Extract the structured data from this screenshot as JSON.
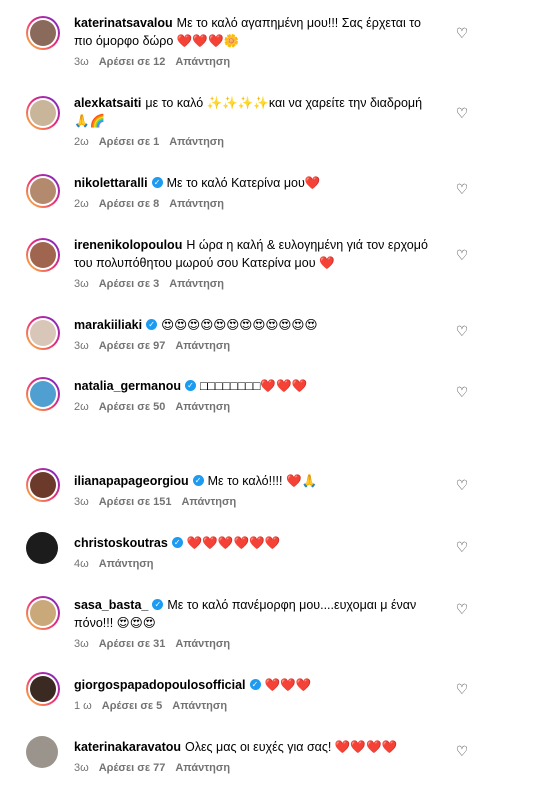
{
  "comments": [
    {
      "user": "katerinatsavalou",
      "verified": false,
      "text": "Με το καλό αγαπημένη μου!!! Σας έρχεται το πιο όμορφο δώρο ❤️❤️❤️🌼",
      "time": "3ω",
      "likes": "Αρέσει σε 12",
      "reply": "Απάντηση"
    },
    {
      "user": "alexkatsaiti",
      "verified": false,
      "text": "με το καλό ✨✨✨✨και να χαρείτε την διαδρομή 🙏🌈",
      "time": "2ω",
      "likes": "Αρέσει σε 1",
      "reply": "Απάντηση"
    },
    {
      "user": "nikolettaralli",
      "verified": true,
      "text": "Με το καλό Κατερίνα μου❤️",
      "time": "2ω",
      "likes": "Αρέσει σε 8",
      "reply": "Απάντηση"
    },
    {
      "user": "irenenikolopoulou",
      "verified": false,
      "text": "Η ώρα η καλή & ευλογημένη γιά τον ερχομό του πολυπόθητου μωρού σου Κατερίνα μου ❤️",
      "time": "3ω",
      "likes": "Αρέσει σε 3",
      "reply": "Απάντηση"
    },
    {
      "user": "marakiiliaki",
      "verified": true,
      "text": "😍😍😍😍😍😍😍😍😍😍😍😍",
      "time": "3ω",
      "likes": "Αρέσει σε 97",
      "reply": "Απάντηση"
    },
    {
      "user": "natalia_germanou",
      "verified": true,
      "text": "□□□□□□□□❤️❤️❤️",
      "time": "2ω",
      "likes": "Αρέσει σε 50",
      "reply": "Απάντηση"
    },
    {
      "user": "ilianapapageorgiou",
      "verified": true,
      "text": "Με το καλό!!!! ❤️🙏",
      "time": "3ω",
      "likes": "Αρέσει σε 151",
      "reply": "Απάντηση"
    },
    {
      "user": "christoskoutras",
      "verified": true,
      "text": "❤️❤️❤️❤️❤️❤️",
      "time": "4ω",
      "likes": "",
      "reply": "Απάντηση"
    },
    {
      "user": "sasa_basta_",
      "verified": true,
      "text": "Με το καλό πανέμορφη μου....ευχομαι μ έναν πόνο!!! 😍😍😍",
      "time": "3ω",
      "likes": "Αρέσει σε 31",
      "reply": "Απάντηση"
    },
    {
      "user": "giorgospapadopoulosofficial",
      "verified": true,
      "text": "❤️❤️❤️",
      "time": "1 ω",
      "likes": "Αρέσει σε 5",
      "reply": "Απάντηση"
    },
    {
      "user": "katerinakaravatou",
      "verified": false,
      "text": "Ολες μας οι ευχές για σας! ❤️❤️❤️❤️",
      "time": "3ω",
      "likes": "Αρέσει σε 77",
      "reply": "Απάντηση"
    }
  ],
  "colors": {
    "meta": "#737373",
    "verified": "#1d9bf0",
    "text": "#000000"
  },
  "icons": {
    "verified": "verified-check-icon",
    "like": "heart-outline-icon"
  }
}
